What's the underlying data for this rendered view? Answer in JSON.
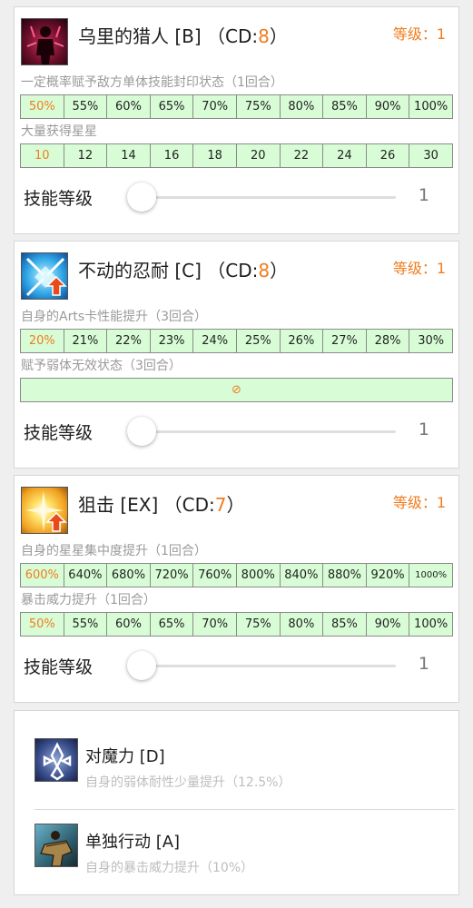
{
  "skills": [
    {
      "name": "乌里的猎人 [B]",
      "cd_prefix": "（CD:",
      "cd": "8",
      "cd_suffix": "）",
      "level_text": "等级：1",
      "icon": "hunter-silhouette-icon",
      "effects": [
        {
          "desc": "一定概率赋予敌方单体技能封印状态（1回合）",
          "values": [
            "50%",
            "55%",
            "60%",
            "65%",
            "70%",
            "75%",
            "80%",
            "85%",
            "90%",
            "100%"
          ]
        },
        {
          "desc": "大量获得星星",
          "values": [
            "10",
            "12",
            "14",
            "16",
            "18",
            "20",
            "22",
            "24",
            "26",
            "30"
          ]
        }
      ],
      "slider_label": "技能等级",
      "slider_value": "1"
    },
    {
      "name": "不动的忍耐 [C]",
      "cd_prefix": "（CD:",
      "cd": "8",
      "cd_suffix": "）",
      "level_text": "等级：1",
      "icon": "arts-up-icon",
      "effects": [
        {
          "desc": "自身的Arts卡性能提升（3回合）",
          "values": [
            "20%",
            "21%",
            "22%",
            "23%",
            "24%",
            "25%",
            "26%",
            "27%",
            "28%",
            "30%"
          ]
        },
        {
          "desc": "赋予弱体无效状态（3回合）",
          "values": [
            "⊘"
          ]
        }
      ],
      "slider_label": "技能等级",
      "slider_value": "1"
    },
    {
      "name": "狙击 [EX]",
      "cd_prefix": "（CD:",
      "cd": "7",
      "cd_suffix": "）",
      "level_text": "等级：1",
      "icon": "star-burst-up-icon",
      "effects": [
        {
          "desc": "自身的星星集中度提升（1回合）",
          "values": [
            "600%",
            "640%",
            "680%",
            "720%",
            "760%",
            "800%",
            "840%",
            "880%",
            "920%",
            "1000%"
          ]
        },
        {
          "desc": "暴击威力提升（1回合）",
          "values": [
            "50%",
            "55%",
            "60%",
            "65%",
            "70%",
            "75%",
            "80%",
            "85%",
            "90%",
            "100%"
          ]
        }
      ],
      "slider_label": "技能等级",
      "slider_value": "1"
    }
  ],
  "passives": [
    {
      "name": "对魔力 [D]",
      "desc": "自身的弱体耐性少量提升（12.5%）",
      "icon": "magic-resistance-icon"
    },
    {
      "name": "单独行动 [A]",
      "desc": "自身的暴击威力提升（10%）",
      "icon": "independent-action-icon"
    }
  ],
  "colors": {
    "accent_orange": "#f07c1e",
    "table_fill": "#d8fdd6",
    "card_bg": "#ffffff",
    "page_bg": "#efefef"
  }
}
